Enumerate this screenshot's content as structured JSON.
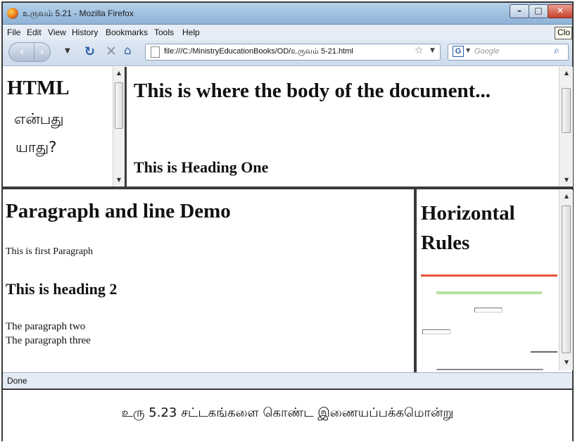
{
  "window": {
    "title": "உருவம் 5.21 - Mozilla Firefox",
    "buttons": {
      "minimize": "–",
      "maximize": "□",
      "close": "✕"
    }
  },
  "menu": {
    "items": [
      "File",
      "Edit",
      "View",
      "History",
      "Bookmarks",
      "Tools",
      "Help"
    ],
    "tooltip": "Clo"
  },
  "navbar": {
    "back": "‹",
    "forward": "›",
    "url": "file:///C:/MinistryEducationBooks/OD/உருவம் 5-21.html",
    "search_placeholder": "Google",
    "search_engine_letter": "G"
  },
  "frames": {
    "left": {
      "heading": "HTML",
      "text_line1": "என்பது",
      "text_line2": "யாது?"
    },
    "top_right": {
      "heading1": "This is where the body of the document...",
      "heading2": "This is Heading One"
    },
    "bottom_left": {
      "heading1": "Paragraph and line Demo",
      "paragraph1": "This is first Paragraph",
      "heading2": "This is heading 2",
      "paragraph2": "The paragraph two",
      "paragraph3": "The paragraph three"
    },
    "bottom_right": {
      "heading": "Horizontal Rules",
      "rule_colors": [
        "#e8553a",
        "#b7e0a0",
        "#8a8a8a"
      ]
    }
  },
  "status": {
    "text": "Done"
  },
  "caption": {
    "text": "உரு 5.23 சட்டகங்களை கொண்ட இணையப்பக்கமொன்று"
  }
}
